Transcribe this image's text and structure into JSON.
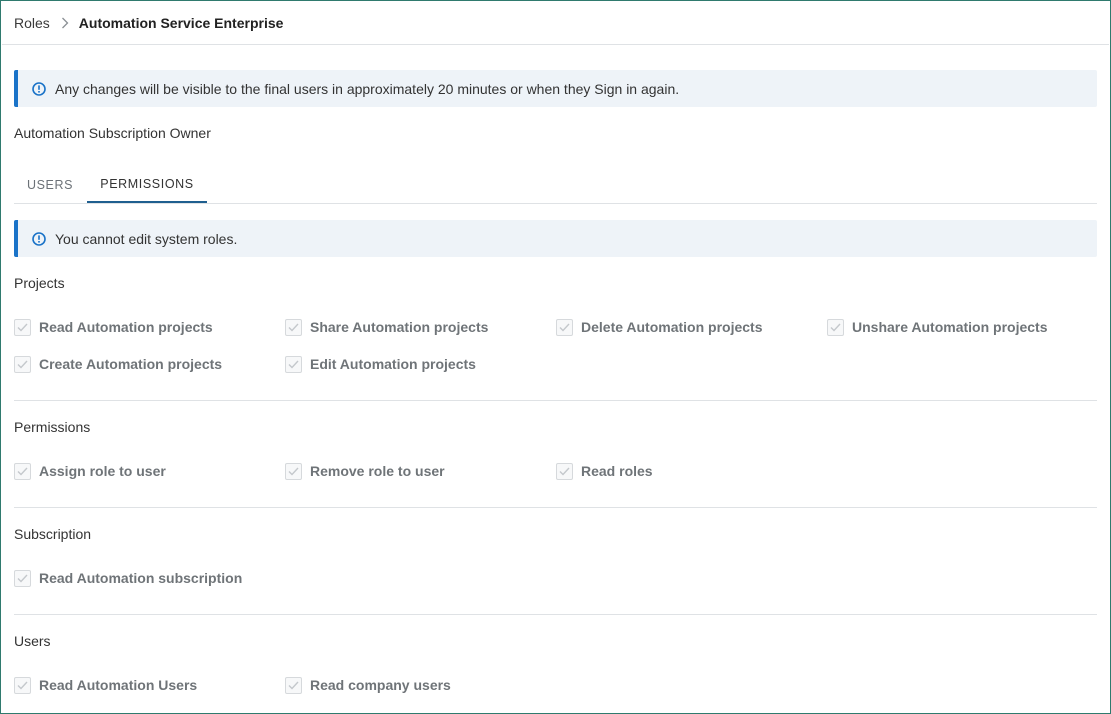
{
  "breadcrumb": {
    "parent": "Roles",
    "current": "Automation Service Enterprise"
  },
  "notice": "Any changes will be visible to the final users in approximately 20 minutes or when they Sign in again.",
  "role_name": "Automation Subscription Owner",
  "tabs": [
    {
      "label": "USERS",
      "active": false
    },
    {
      "label": "PERMISSIONS",
      "active": true
    }
  ],
  "system_notice": "You cannot edit system roles.",
  "sections": {
    "projects": {
      "title": "Projects",
      "items": [
        {
          "label": "Read Automation projects",
          "checked": true
        },
        {
          "label": "Share Automation projects",
          "checked": true
        },
        {
          "label": "Delete Automation projects",
          "checked": true
        },
        {
          "label": "Unshare Automation projects",
          "checked": true
        },
        {
          "label": "Create Automation projects",
          "checked": true
        },
        {
          "label": "Edit Automation projects",
          "checked": true
        }
      ]
    },
    "permissions": {
      "title": "Permissions",
      "items": [
        {
          "label": "Assign role to user",
          "checked": true
        },
        {
          "label": "Remove role to user",
          "checked": true
        },
        {
          "label": "Read roles",
          "checked": true
        }
      ]
    },
    "subscription": {
      "title": "Subscription",
      "items": [
        {
          "label": "Read Automation subscription",
          "checked": true
        }
      ]
    },
    "users": {
      "title": "Users",
      "items": [
        {
          "label": "Read Automation Users",
          "checked": true
        },
        {
          "label": "Read company users",
          "checked": true
        }
      ]
    }
  },
  "colors": {
    "accent": "#1a73c8",
    "banner_bg": "#eef3f8",
    "tab_underline": "#1f5f8f",
    "frame_border": "#2f7a6e"
  },
  "icons": {
    "breadcrumb_separator": "chevron-right-icon",
    "info": "info-circle-icon",
    "checkbox_mark": "check-icon"
  }
}
